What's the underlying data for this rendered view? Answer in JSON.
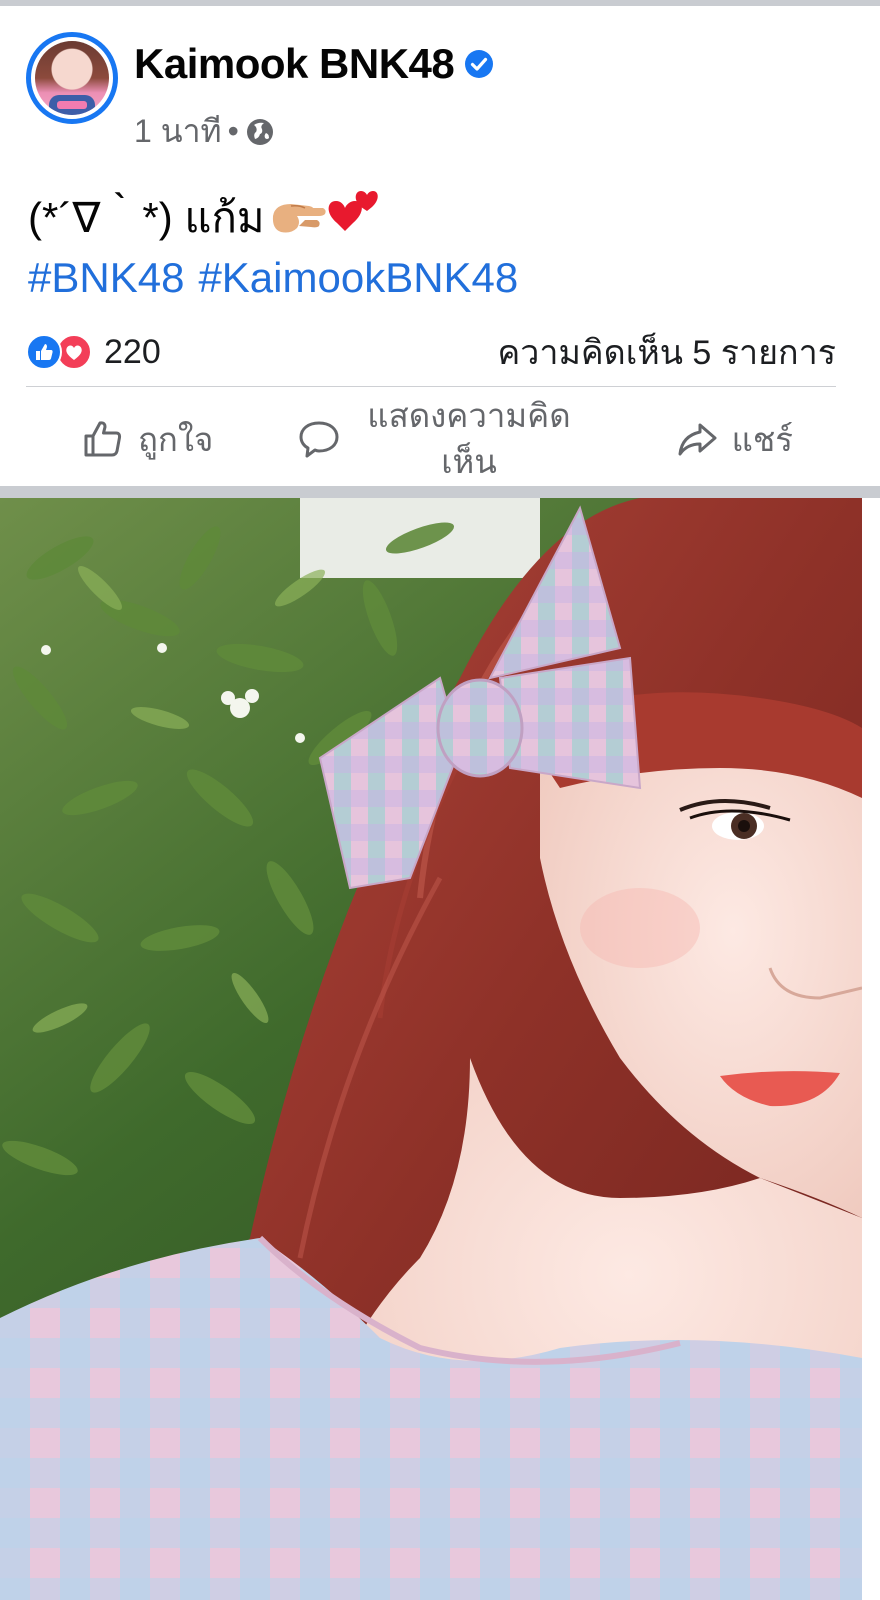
{
  "post": {
    "author": "Kaimook BNK48",
    "verified": true,
    "timestamp": "1 นาที",
    "separator": "•",
    "privacy_icon": "globe-icon",
    "text": "(*´∇｀*) แก้ม",
    "text_emojis": [
      "pinching-hand-emoji",
      "two-hearts-emoji"
    ],
    "hashtags": [
      "#BNK48",
      "#KaimookBNK48"
    ]
  },
  "reactions": {
    "icons": [
      "like-icon",
      "love-icon"
    ],
    "count": "220",
    "comments": "ความคิดเห็น 5 รายการ"
  },
  "actions": {
    "like": "ถูกใจ",
    "comment": "แสดงความคิดเห็น",
    "share": "แชร์"
  },
  "colors": {
    "accent": "#1877f2",
    "hashtag": "#216fdb",
    "muted": "#65676b",
    "love": "#f33e58"
  }
}
